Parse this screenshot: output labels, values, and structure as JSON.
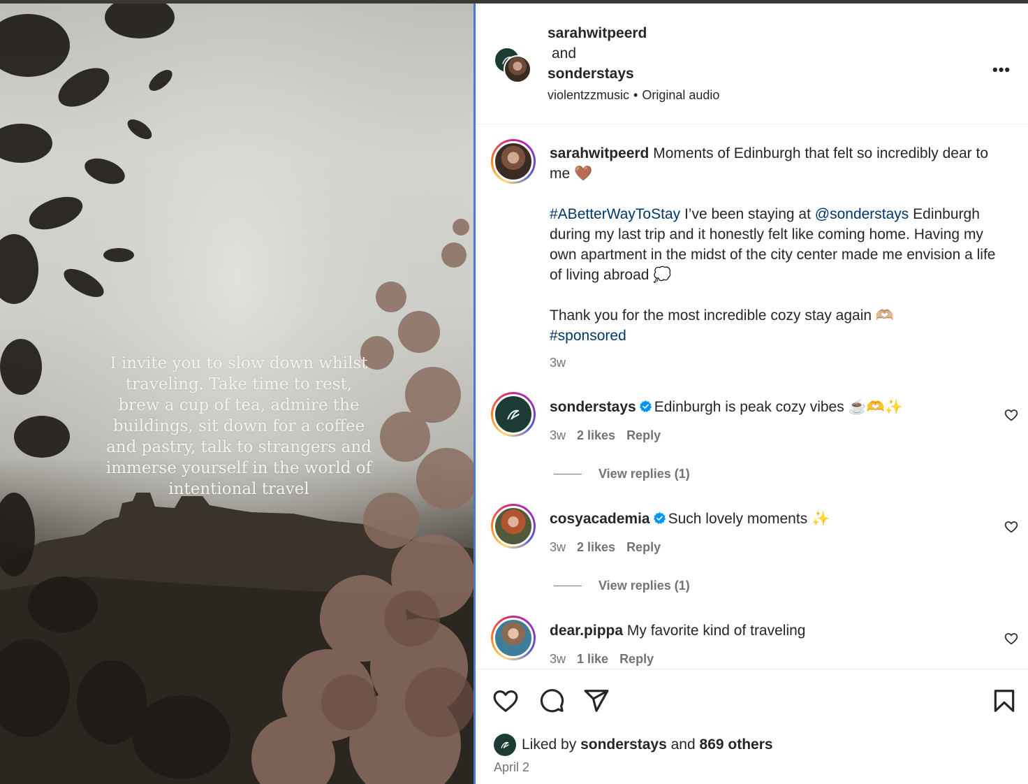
{
  "header": {
    "author": "sarahwitpeerd",
    "joiner": "and",
    "collaborator": "sonderstays",
    "audio_artist": "violentzzmusic",
    "audio_separator": "•",
    "audio_label": "Original audio",
    "more_label": "•••"
  },
  "media": {
    "overlay_text": "I invite you to slow down whilst traveling. Take time  to rest, brew a cup of tea, admire the buildings, sit down for a coffee and pastry, talk to strangers and immerse yourself in the world of intentional travel"
  },
  "caption": {
    "username": "sarahwitpeerd",
    "line1": "Moments of Edinburgh that felt so incredibly dear to me 🤎",
    "hashtag1": "#ABetterWayToStay",
    "text2a": " I’ve been staying at ",
    "mention": "@sonderstays",
    "text2b": " Edinburgh during my last trip and it honestly felt like coming home. Having my own apartment in the midst of the city center made me envision a life of living abroad 💭",
    "line3": "Thank you for the most incredible cozy stay again 🫶🏼",
    "hashtag2": "#sponsored",
    "time": "3w"
  },
  "comments": [
    {
      "username": "sonderstays",
      "verified": true,
      "text": "Edinburgh is peak cozy vibes ☕️🫶✨",
      "time": "3w",
      "likes": "2 likes",
      "reply": "Reply",
      "view_replies": "View replies (1)"
    },
    {
      "username": "cosyacademia",
      "verified": true,
      "text": "Such lovely moments ✨",
      "time": "3w",
      "likes": "2 likes",
      "reply": "Reply",
      "view_replies": "View replies (1)"
    },
    {
      "username": "dear.pippa",
      "verified": false,
      "text": "My favorite kind of traveling",
      "time": "3w",
      "likes": "1 like",
      "reply": "Reply"
    }
  ],
  "footer": {
    "liked_prefix": "Liked by ",
    "liked_user": "sonderstays",
    "liked_mid": " and ",
    "liked_others": "869 others",
    "date": "April 2"
  },
  "colors": {
    "link": "#00376b",
    "verified": "#0095f6",
    "brand_dark": "#1d3b35",
    "window_focus": "#4a78d6"
  },
  "icons": [
    "more-icon",
    "heart-icon",
    "comment-icon",
    "share-icon",
    "bookmark-icon",
    "verified-icon",
    "sonder-logo-icon"
  ]
}
